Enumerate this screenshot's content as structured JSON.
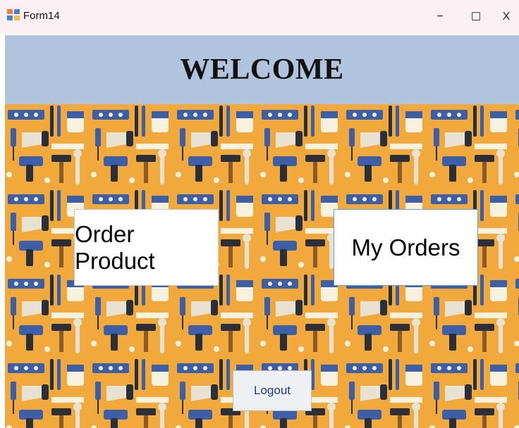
{
  "window": {
    "title": "Form14",
    "controls": {
      "minimize": "−",
      "maximize": "☐",
      "close": "X"
    }
  },
  "header": {
    "welcome": "WELCOME"
  },
  "buttons": {
    "order_product": "Order Product",
    "my_orders": "My Orders",
    "logout": "Logout"
  },
  "colors": {
    "titlebar_bg": "#fbf1f4",
    "header_bg": "#b0c4de",
    "pattern_bg": "#f2a93b",
    "pattern_blue": "#3c5fa8",
    "pattern_dark": "#2a2f3a"
  },
  "icons": [
    "app-form-icon",
    "tools-pattern-background"
  ]
}
